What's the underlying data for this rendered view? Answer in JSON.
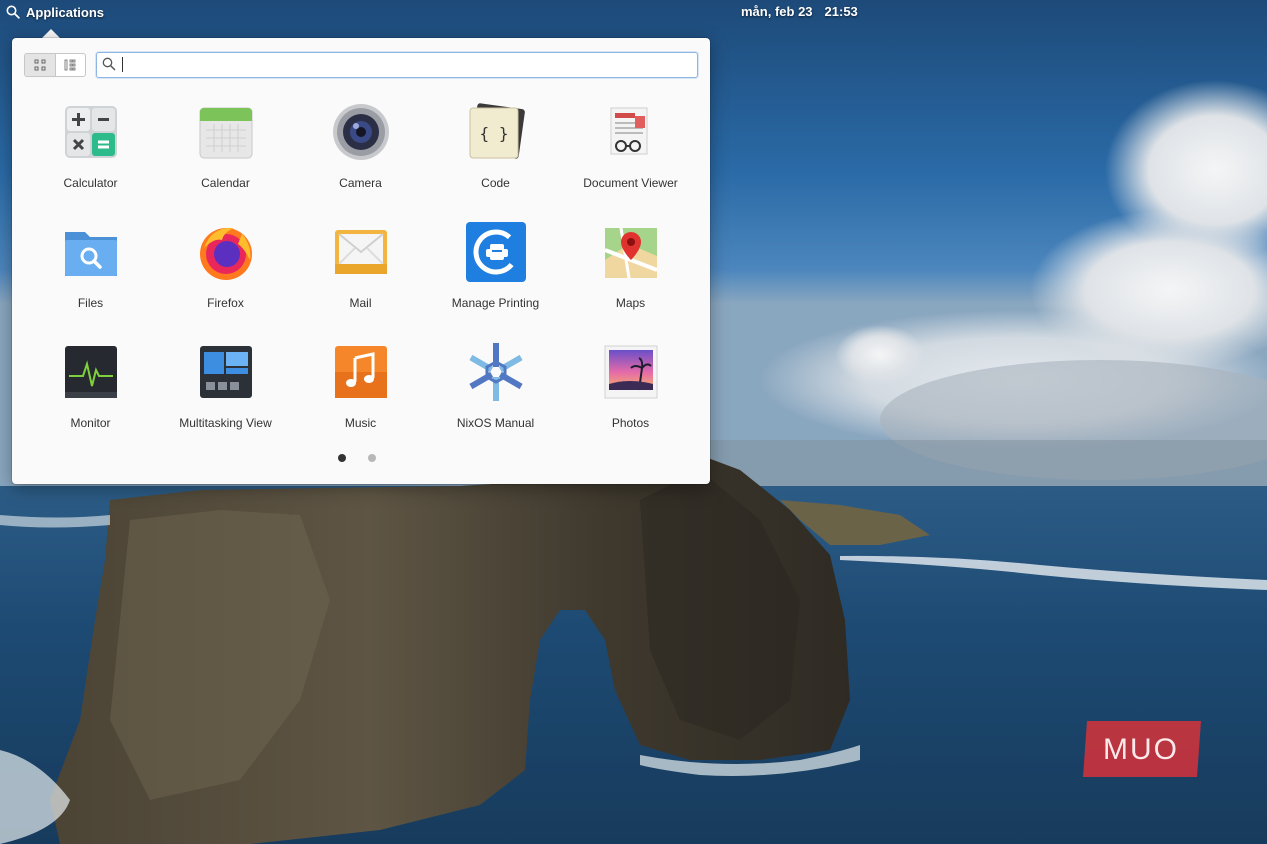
{
  "panel": {
    "applications_label": "Applications",
    "date": "mån, feb 23",
    "time": "21:53"
  },
  "launcher": {
    "search": {
      "value": "",
      "placeholder": ""
    },
    "view_modes": [
      "grid-view-icon",
      "category-view-icon"
    ],
    "apps": [
      {
        "label": "Calculator",
        "icon": "calculator-icon"
      },
      {
        "label": "Calendar",
        "icon": "calendar-icon"
      },
      {
        "label": "Camera",
        "icon": "camera-icon"
      },
      {
        "label": "Code",
        "icon": "code-icon"
      },
      {
        "label": "Document Viewer",
        "icon": "document-viewer-icon"
      },
      {
        "label": "Files",
        "icon": "files-icon"
      },
      {
        "label": "Firefox",
        "icon": "firefox-icon"
      },
      {
        "label": "Mail",
        "icon": "mail-icon"
      },
      {
        "label": "Manage Printing",
        "icon": "printer-icon"
      },
      {
        "label": "Maps",
        "icon": "maps-icon"
      },
      {
        "label": "Monitor",
        "icon": "monitor-icon"
      },
      {
        "label": "Multitasking View",
        "icon": "multitasking-icon"
      },
      {
        "label": "Music",
        "icon": "music-icon"
      },
      {
        "label": "NixOS Manual",
        "icon": "nixos-icon"
      },
      {
        "label": "Photos",
        "icon": "photos-icon"
      }
    ],
    "page_count": 2,
    "current_page": 1
  },
  "watermark": {
    "text": "MUO"
  },
  "colors": {
    "popover_bg": "#fafafa",
    "search_focus": "#8fb6e3",
    "watermark": "#d6323a"
  }
}
